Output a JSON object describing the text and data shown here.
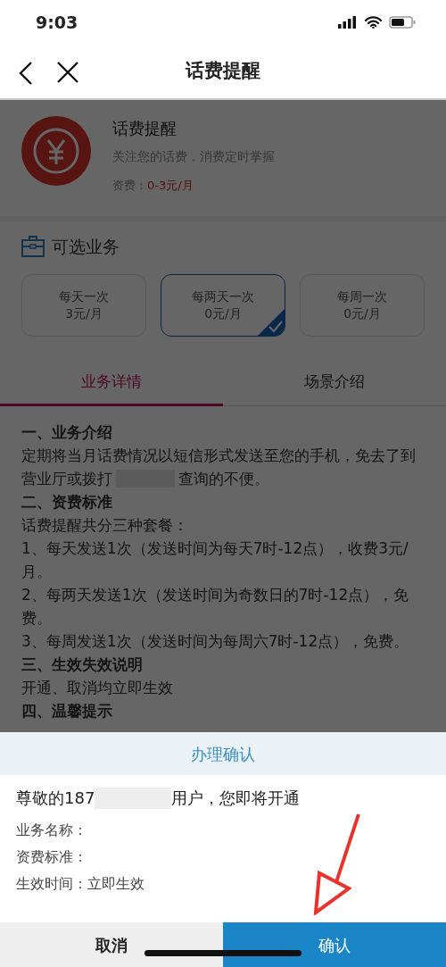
{
  "status_bar": {
    "time": "9:03"
  },
  "nav": {
    "title": "话费提醒"
  },
  "product": {
    "name": "话费提醒",
    "tagline": "关注您的话费，消费定时掌握",
    "price_label": "资费：",
    "price": "0-3元/月"
  },
  "options": {
    "title": "可选业务",
    "items": [
      {
        "name": "每天一次",
        "price": "3元/月",
        "selected": false
      },
      {
        "name": "每两天一次",
        "price": "0元/月",
        "selected": true
      },
      {
        "name": "每周一次",
        "price": "0元/月",
        "selected": false
      }
    ]
  },
  "tabs": [
    {
      "label": "业务详情",
      "selected": true
    },
    {
      "label": "场景介绍",
      "selected": false
    }
  ],
  "details": [
    {
      "kind": "heading",
      "text": "一、业务介绍"
    },
    {
      "kind": "text",
      "text": "定期将当月话费情况以短信形式发送至您的手机，免去了到"
    },
    {
      "kind": "redacted",
      "before": "营业厅或拨打",
      "after": "查询的不便。"
    },
    {
      "kind": "heading",
      "text": "二、资费标准"
    },
    {
      "kind": "text",
      "text": "话费提醒共分三种套餐："
    },
    {
      "kind": "text",
      "text": "1、每天发送1次（发送时间为每天7时-12点），收费3元/月。"
    },
    {
      "kind": "text",
      "text": "2、每两天发送1次（发送时间为奇数日的7时-12点），免费。"
    },
    {
      "kind": "text",
      "text": "3、每周发送1次（发送时间为每周六7时-12点），免费。"
    },
    {
      "kind": "heading",
      "text": "三、生效失效说明"
    },
    {
      "kind": "text",
      "text": "开通、取消均立即生效"
    },
    {
      "kind": "heading",
      "text": "四、温馨提示"
    }
  ],
  "dialog": {
    "title": "办理确认",
    "greeting_before": "尊敬的187",
    "greeting_after": "用户，您即将开通",
    "fields": [
      {
        "label": "业务名称："
      },
      {
        "label": "资费标准："
      },
      {
        "label": "生效时间：",
        "value": "立即生效"
      }
    ],
    "buttons": [
      {
        "label": "取消",
        "kind": "cancel"
      },
      {
        "label": "确认",
        "kind": "confirm"
      }
    ]
  }
}
